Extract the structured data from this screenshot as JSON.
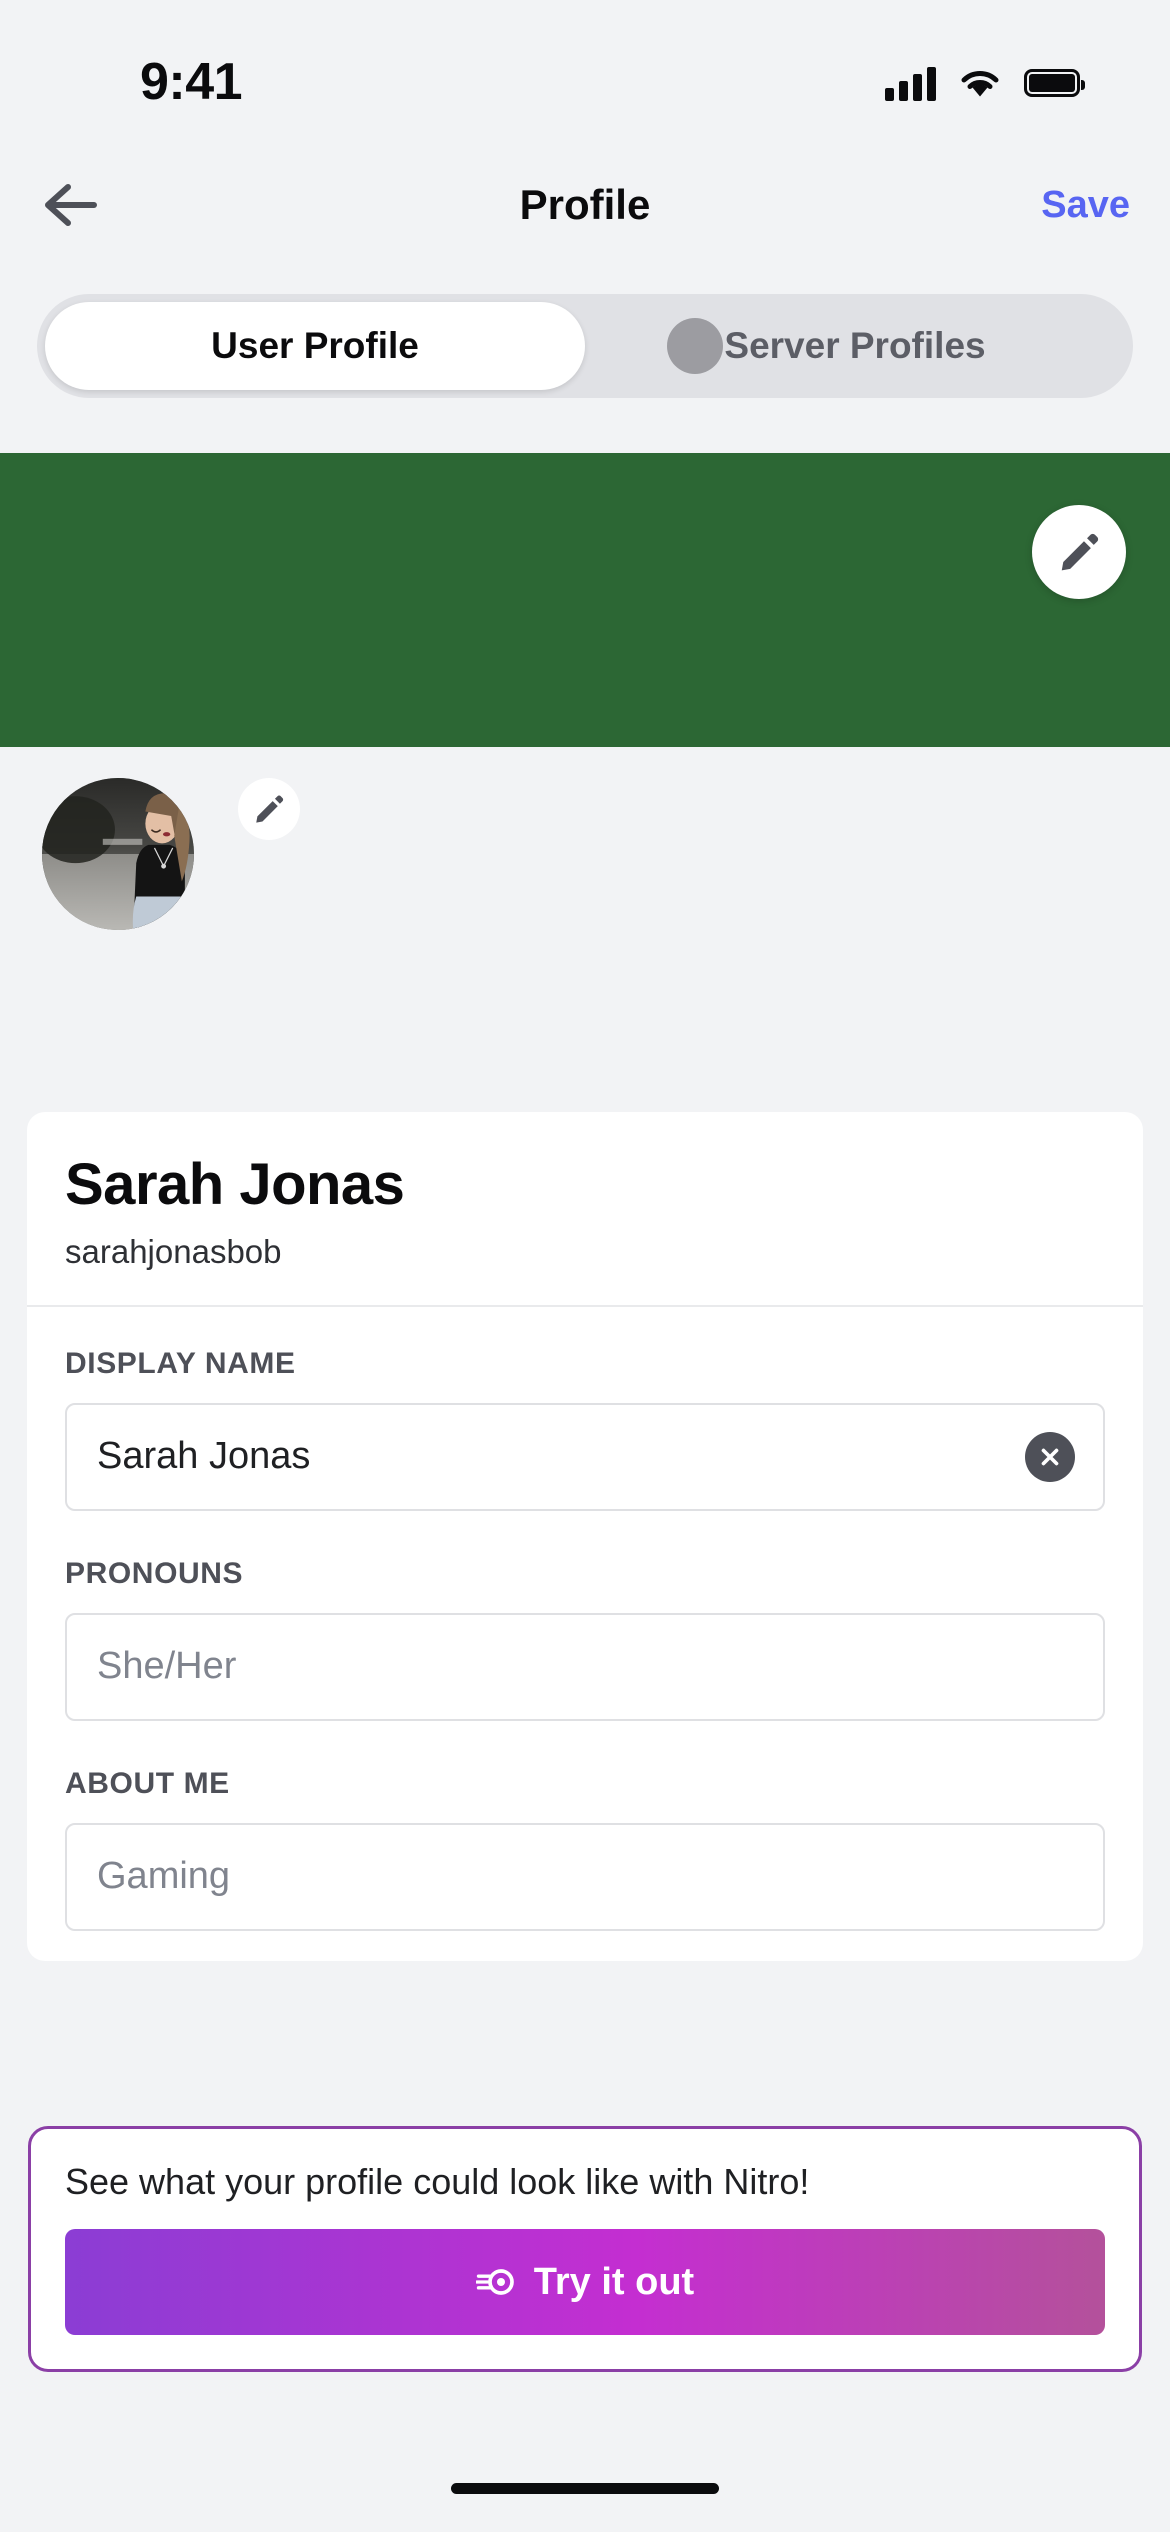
{
  "statusbar": {
    "time": "9:41",
    "signal_icon": "cellular-signal-icon",
    "wifi_icon": "wifi-icon",
    "battery_icon": "battery-full-icon"
  },
  "navbar": {
    "back_icon": "back-arrow-icon",
    "title": "Profile",
    "save_label": "Save",
    "save_color": "#5865f2"
  },
  "tabs": {
    "items": [
      {
        "label": "User Profile",
        "active": true
      },
      {
        "label": "Server Profiles",
        "active": false
      }
    ],
    "touch_indicator": "touch-point-indicator"
  },
  "banner": {
    "color": "#2c6734",
    "edit_icon": "pencil-icon"
  },
  "avatar": {
    "alt": "user-avatar-photo",
    "edit_icon": "pencil-icon"
  },
  "profile_card": {
    "display_name": "Sarah Jonas",
    "username": "sarahjonasbob",
    "fields": [
      {
        "label": "DISPLAY NAME",
        "value": "Sarah Jonas",
        "placeholder": "",
        "has_clear": true,
        "clear_icon": "close-circle-icon"
      },
      {
        "label": "PRONOUNS",
        "value": "",
        "placeholder": "She/Her",
        "has_clear": false,
        "clear_icon": ""
      },
      {
        "label": "ABOUT ME",
        "value": "",
        "placeholder": "Gaming",
        "has_clear": false,
        "clear_icon": ""
      }
    ]
  },
  "nitro_promo": {
    "text": "See what your profile could look like with Nitro!",
    "button_label": "Try it out",
    "button_icon": "nitro-boost-icon",
    "border_color": "#8b3fa6",
    "gradient_from": "#8b3dd4",
    "gradient_to": "#b4519b"
  },
  "home_indicator": "home-indicator-bar"
}
